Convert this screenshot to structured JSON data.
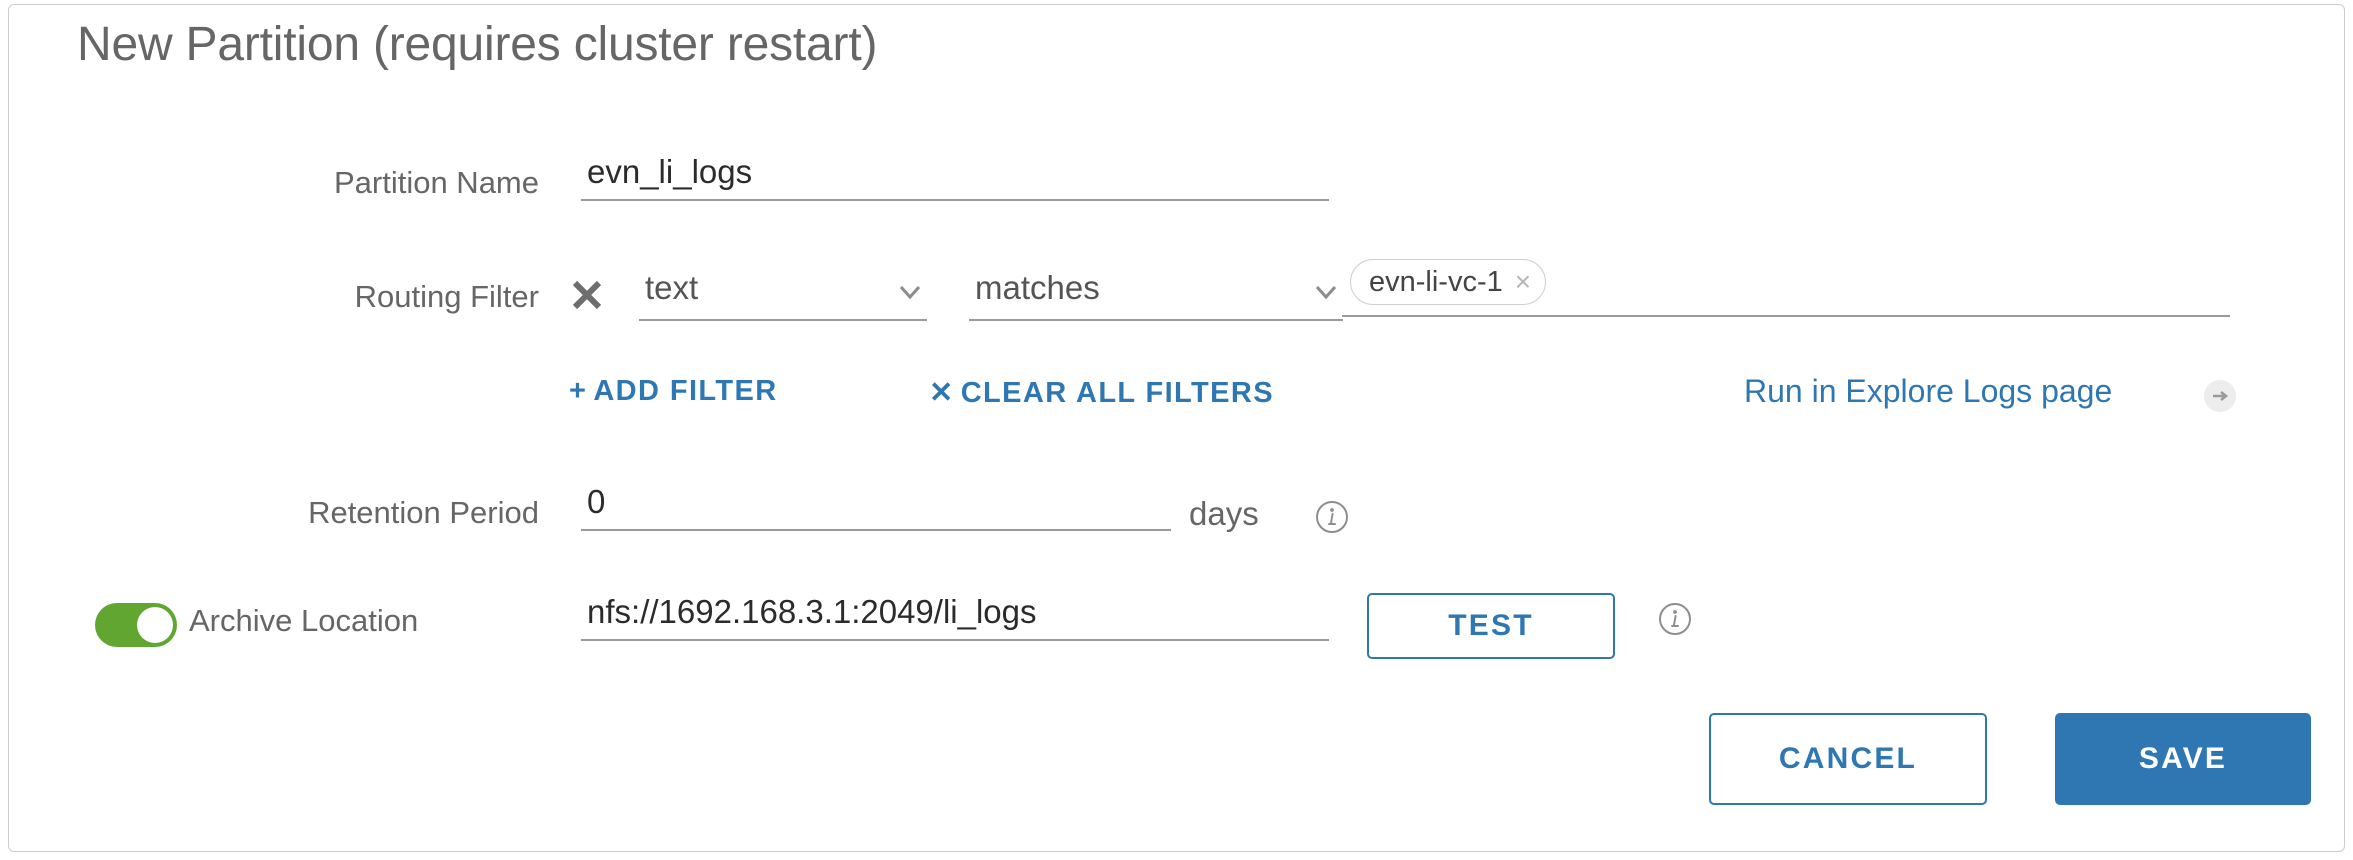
{
  "dialog": {
    "title": "New Partition (requires cluster restart)"
  },
  "fields": {
    "partition_name": {
      "label": "Partition Name",
      "value": "evn_li_logs",
      "placeholder": ""
    },
    "routing_filter": {
      "label": "Routing Filter",
      "remove_icon": "close-icon",
      "field_select": {
        "value": "text",
        "chevron": "chevron-down-icon"
      },
      "operator_select": {
        "value": "matches",
        "chevron": "chevron-down-icon"
      },
      "tags": [
        {
          "label": "evn-li-vc-1",
          "remove": "×"
        }
      ],
      "tag_placeholder": ""
    },
    "retention_period": {
      "label": "Retention Period",
      "value": "0",
      "placeholder": "",
      "unit": "days",
      "info_icon": "info-icon"
    },
    "archive_location": {
      "label": "Archive Location",
      "toggle_on": true,
      "value": "nfs://1692.168.3.1:2049/li_logs",
      "placeholder": "",
      "info_icon": "info-icon"
    }
  },
  "filter_actions": {
    "add_filter": {
      "glyph": "+",
      "label": "ADD FILTER"
    },
    "clear_all": {
      "glyph": "✕",
      "label": "CLEAR ALL FILTERS"
    },
    "explore_link": {
      "label": "Run in Explore Logs page",
      "icon": "arrow-right-circle-icon"
    }
  },
  "buttons": {
    "test": "TEST",
    "cancel": "CANCEL",
    "save": "SAVE"
  },
  "colors": {
    "accent_blue": "#2f77b3",
    "toggle_green": "#60a630",
    "label_gray": "#666666",
    "underline_gray": "#9a9a9a"
  }
}
